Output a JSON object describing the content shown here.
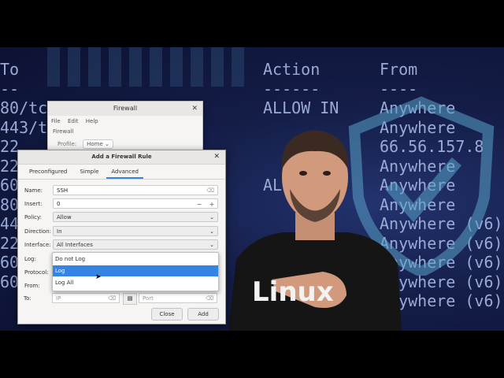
{
  "terminal": {
    "left_column": [
      "To",
      "--",
      "80/tc",
      "443/t",
      "22",
      "22",
      "60",
      "80",
      "44",
      "22",
      "60",
      "60"
    ],
    "action_column": [
      "Action",
      "------",
      "ALLOW IN",
      "",
      "",
      "",
      "ALLOW IN",
      "",
      "",
      "",
      "",
      ""
    ],
    "from_column": [
      "From",
      "----",
      "Anywhere",
      "Anywhere",
      "66.56.157.8",
      "Anywhere",
      "Anywhere",
      "Anywhere",
      "Anywhere (v6)",
      "Anywhere (v6)",
      "Anywhere (v6)",
      "Anywhere (v6)",
      "Anywhere (v6)"
    ]
  },
  "shirt_text": "Linux",
  "firewall_window": {
    "title": "Firewall",
    "menu": [
      "File",
      "Edit",
      "Help"
    ],
    "section": "Firewall",
    "profile_label": "Profile:",
    "profile_value": "Home"
  },
  "dialog": {
    "title": "Add a Firewall Rule",
    "tabs": [
      "Preconfigured",
      "Simple",
      "Advanced"
    ],
    "active_tab": "Advanced",
    "name_label": "Name:",
    "name_value": "SSH",
    "insert_label": "Insert:",
    "insert_value": "0",
    "policy_label": "Policy:",
    "policy_value": "Allow",
    "direction_label": "Direction:",
    "direction_value": "In",
    "interface_label": "Interface:",
    "interface_value": "All Interfaces",
    "log_label": "Log:",
    "protocol_label": "Protocol:",
    "from_label": "From:",
    "to_label": "To:",
    "ip_placeholder": "IP",
    "port_placeholder": "Port",
    "log_options": [
      "Do not Log",
      "Log",
      "Log All"
    ],
    "log_selected": "Log",
    "close_label": "Close",
    "add_label": "Add"
  },
  "colors": {
    "accent": "#3584e4",
    "background": "#141d47",
    "terminal_text": "#9aa9d6"
  }
}
